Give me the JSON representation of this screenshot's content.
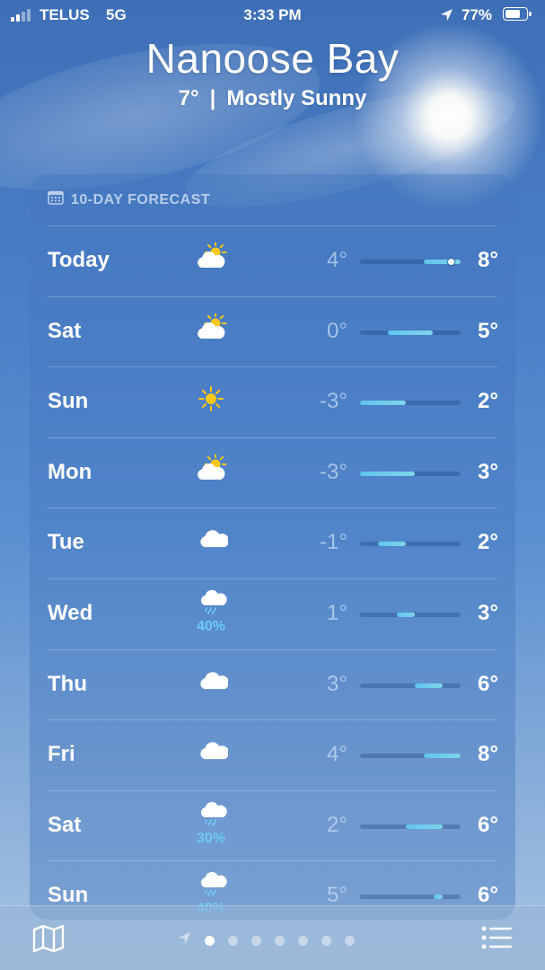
{
  "status_bar": {
    "carrier": "TELUS",
    "network": "5G",
    "time": "3:33 PM",
    "battery_percent": "77%",
    "battery_level": 0.77,
    "location_icon": "location-arrow-icon"
  },
  "header": {
    "city": "Nanoose Bay",
    "current_temp": "7°",
    "separator": "|",
    "condition": "Mostly Sunny"
  },
  "forecast": {
    "title": "10-DAY FORECAST",
    "title_icon": "calendar-icon",
    "range_min": -3,
    "range_max": 8,
    "current_temp_value": 7,
    "days": [
      {
        "day": "Today",
        "icon": "partly-sunny-icon",
        "precip": "",
        "low": "4°",
        "high": "8°",
        "low_value": 4,
        "high_value": 8,
        "current": true
      },
      {
        "day": "Sat",
        "icon": "partly-sunny-icon",
        "precip": "",
        "low": "0°",
        "high": "5°",
        "low_value": 0,
        "high_value": 5
      },
      {
        "day": "Sun",
        "icon": "sunny-icon",
        "precip": "",
        "low": "-3°",
        "high": "2°",
        "low_value": -3,
        "high_value": 2
      },
      {
        "day": "Mon",
        "icon": "partly-sunny-icon",
        "precip": "",
        "low": "-3°",
        "high": "3°",
        "low_value": -3,
        "high_value": 3
      },
      {
        "day": "Tue",
        "icon": "cloudy-icon",
        "precip": "",
        "low": "-1°",
        "high": "2°",
        "low_value": -1,
        "high_value": 2
      },
      {
        "day": "Wed",
        "icon": "rain-icon",
        "precip": "40%",
        "low": "1°",
        "high": "3°",
        "low_value": 1,
        "high_value": 3
      },
      {
        "day": "Thu",
        "icon": "cloudy-icon",
        "precip": "",
        "low": "3°",
        "high": "6°",
        "low_value": 3,
        "high_value": 6
      },
      {
        "day": "Fri",
        "icon": "cloudy-icon",
        "precip": "",
        "low": "4°",
        "high": "8°",
        "low_value": 4,
        "high_value": 8
      },
      {
        "day": "Sat",
        "icon": "rain-icon",
        "precip": "30%",
        "low": "2°",
        "high": "6°",
        "low_value": 2,
        "high_value": 6
      },
      {
        "day": "Sun",
        "icon": "rain-icon",
        "precip": "40%",
        "low": "5°",
        "high": "6°",
        "low_value": 5,
        "high_value": 6
      }
    ]
  },
  "toolbar": {
    "map_icon": "map-icon",
    "list_icon": "list-icon",
    "page_count": 7,
    "active_page": 0,
    "current_location_icon": "location-arrow-icon"
  },
  "colors": {
    "sun": "#f9c81a",
    "precip": "#6ccbf5",
    "bar": "#5ec4ee"
  }
}
